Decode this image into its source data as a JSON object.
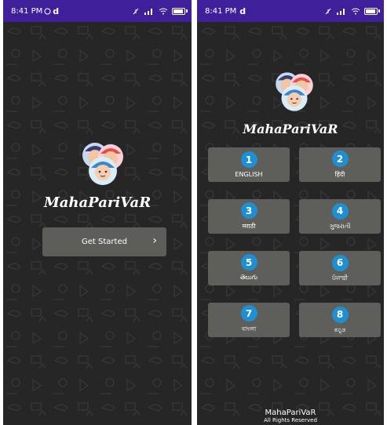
{
  "screen1": {
    "status": {
      "time": "8:41 PM",
      "icons": [
        "whatsapp-icon",
        "d-icon"
      ]
    },
    "brand": "MahaPariVaR",
    "get_started_label": "Get Started",
    "chevron": "›"
  },
  "screen2": {
    "status": {
      "time": "8:41 PM",
      "icons": [
        "d-icon"
      ]
    },
    "brand": "MahaPariVaR",
    "languages": [
      {
        "num": "1",
        "label": "ENGLISH"
      },
      {
        "num": "2",
        "label": "हिंदी"
      },
      {
        "num": "3",
        "label": "मराठी"
      },
      {
        "num": "4",
        "label": "ગુજરાતી"
      },
      {
        "num": "5",
        "label": "తెలుగు"
      },
      {
        "num": "6",
        "label": "ਪੰਜਾਬੀ"
      },
      {
        "num": "7",
        "label": "বাংলা"
      },
      {
        "num": "8",
        "label": "ಕನ್ನಡ"
      }
    ],
    "footer": {
      "name": "MahaPariVaR",
      "rights": "All Rights Reserved"
    }
  },
  "colors": {
    "status_bar": "#3f1f9a",
    "background": "#262626",
    "tile": "#5e5f5a",
    "badge": "#1e8fd0"
  },
  "battery_level": 0.8
}
